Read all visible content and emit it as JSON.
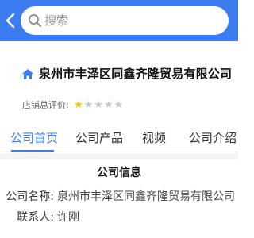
{
  "search": {
    "placeholder": "搜索"
  },
  "company": {
    "name": "泉州市丰泽区同鑫齐隆贸易有限公司",
    "rating_label": "店铺总评价:",
    "rating": {
      "value": 1,
      "max": 5
    }
  },
  "tabs": [
    {
      "label": "公司首页",
      "active": true
    },
    {
      "label": "公司产品",
      "active": false
    },
    {
      "label": "视频",
      "active": false
    },
    {
      "label": "公司介绍",
      "active": false
    }
  ],
  "info": {
    "title": "公司信息",
    "rows": [
      {
        "label": "公司名称:",
        "value": "泉州市丰泽区同鑫齐隆贸易有限公司"
      },
      {
        "label": "联系人:",
        "value": "许刚"
      }
    ]
  },
  "colors": {
    "accent": "#3b7cf0",
    "star_on": "#f3c116",
    "star_off": "#c8c8c8"
  }
}
